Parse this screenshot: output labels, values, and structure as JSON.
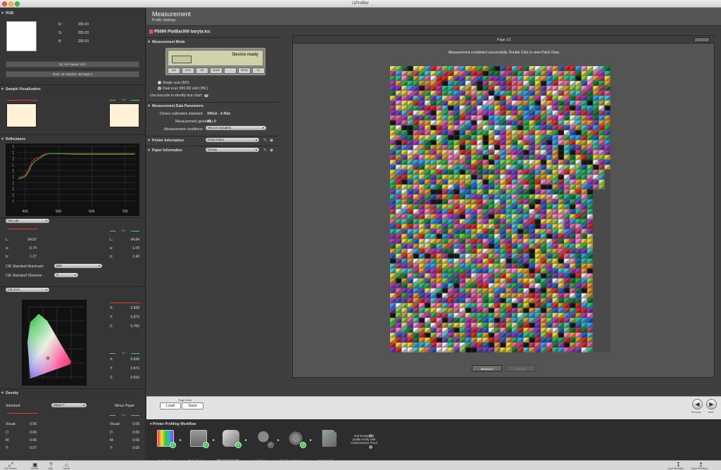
{
  "window": {
    "title": "i1Profiler"
  },
  "left": {
    "rgb": {
      "header": "RGB",
      "r_label": "R:",
      "r": "255.00",
      "g_label": "G:",
      "g": "255.00",
      "b_label": "B:",
      "b": "255.00",
      "id_bar": "ID: N/A     Name: N/A",
      "pos_bar": "Row: 18    Column: 45    Page:1"
    },
    "sample": {
      "header": "Sample Visualization",
      "left_tag": "",
      "right_tag": "M2"
    },
    "reflectance": {
      "header": "Reflectance",
      "x_ticks": [
        "400",
        "500",
        "600",
        "700"
      ],
      "y_ticks": [
        "1.0",
        "0.9",
        "0.8",
        "0.7",
        "0.6",
        "0.5",
        "0.4",
        "0.3",
        "0.2",
        "0.1"
      ]
    },
    "lab": {
      "select": "CIE Lab",
      "right_tag": "M2",
      "rows": [
        {
          "label": "L:",
          "left": "94.87",
          "right": "94.84"
        },
        {
          "label": "a:",
          "left": "-0.74",
          "right": "-1.09"
        },
        {
          "label": "b:",
          "left": "1.27",
          "right": "2.40"
        }
      ],
      "illuminant_label": "CIE Standard Illuminant:",
      "illuminant_value": "D50",
      "observer_label": "CIE Standard Observer :",
      "observer_value": "2°"
    },
    "xyz": {
      "select": "CIE XYZ",
      "right_tag": "M2",
      "top_rows": [
        {
          "label": "X:",
          "value": "0.838"
        },
        {
          "label": "Y:",
          "value": "0.873"
        },
        {
          "label": "Z:",
          "value": "0.706"
        }
      ],
      "bottom_rows": [
        {
          "label": "X:",
          "value": "0.835"
        },
        {
          "label": "Y:",
          "value": "0.872"
        },
        {
          "label": "Z:",
          "value": "0.693"
        }
      ]
    },
    "density": {
      "header": "Density",
      "standard_label": "Standard:",
      "standard_value": "Status T",
      "minus_paper": "Minus Paper",
      "right_tag": "M2",
      "left_rows": [
        {
          "label": "Visual:",
          "value": "0.06"
        },
        {
          "label": "C:",
          "value": "0.06"
        },
        {
          "label": "M:",
          "value": "0.06"
        },
        {
          "label": "Y:",
          "value": "0.07"
        }
      ],
      "right_rows": [
        {
          "label": "Visual:",
          "value": "0.06"
        },
        {
          "label": "C:",
          "value": "0.06"
        },
        {
          "label": "M:",
          "value": "0.06"
        },
        {
          "label": "Y:",
          "value": "0.06"
        }
      ]
    }
  },
  "main": {
    "title": "Measurement",
    "subtitle": "Profile Settings",
    "file_name": "P5000 PlatBar300 baryta.icc",
    "measurement_mode": {
      "header": "Measurement Mode",
      "device_state": "Device ready",
      "device_buttons": [
        "i1iO",
        "i1Pro",
        "OK",
        "SCAN",
        "",
        "XRGA",
        "1/1"
      ],
      "single_scan": "Single scan (M2)",
      "dual_scan": "Dual scan (M0,M2 and OBC)",
      "barcode": "Use barcode to identify test chart:"
    },
    "data_params": {
      "header": "Measurement Data Parameters",
      "device_cal_label": "Device calibration standard:",
      "device_cal_value": "XRGA - X-Rite",
      "geometry_label": "Measurement geometry:",
      "geometry_value": "45 : 0",
      "conditions_label": "Measurement conditions:",
      "conditions_value": "M0 (UV included)"
    },
    "printer_info": {
      "header": "Printer Information",
      "value": "RGB Printer"
    },
    "paper_info": {
      "header": "Paper Information",
      "value": "Glossy"
    },
    "preview": {
      "page": "Page 1/1",
      "message": "Measurement completed successfully. Double Click to view Patch Data.",
      "measure": "Measure",
      "cancel": "Cancel"
    },
    "footer": {
      "page_data": "Page Data",
      "load": "Load",
      "save": "Save",
      "previous": "Previous",
      "next": "Next"
    },
    "workflow": {
      "title": "Printer Profiling Workflow",
      "steps": [
        "Patch Set",
        "Test Chart",
        "Measurement",
        "Lighting",
        "Profile Settings",
        "ICC Profile"
      ],
      "note": "2nd iteration of profile Verify with ColorChecker Proof"
    }
  },
  "bottom_bar": {
    "left": [
      "Full Screen",
      "Modes",
      "Help",
      "Home"
    ],
    "right": [
      "Load Workflow",
      "Save Workflow"
    ]
  },
  "chart_data": {
    "type": "line",
    "x": [
      380,
      400,
      410,
      420,
      430,
      440,
      450,
      460,
      470,
      500,
      550,
      600,
      650,
      700,
      730
    ],
    "series": [
      {
        "values": [
          0.48,
          0.52,
          0.62,
          0.75,
          0.8,
          0.82,
          0.85,
          0.87,
          0.88,
          0.88,
          0.88,
          0.88,
          0.88,
          0.88,
          0.88
        ]
      },
      {
        "values": [
          0.46,
          0.5,
          0.58,
          0.7,
          0.76,
          0.79,
          0.83,
          0.86,
          0.88,
          0.88,
          0.87,
          0.87,
          0.87,
          0.87,
          0.87
        ]
      }
    ],
    "xlim": [
      375,
      735
    ],
    "ylim": [
      0,
      1.0
    ],
    "colors": {
      "series1": "#e43434",
      "series2": "#3bd34b"
    }
  }
}
